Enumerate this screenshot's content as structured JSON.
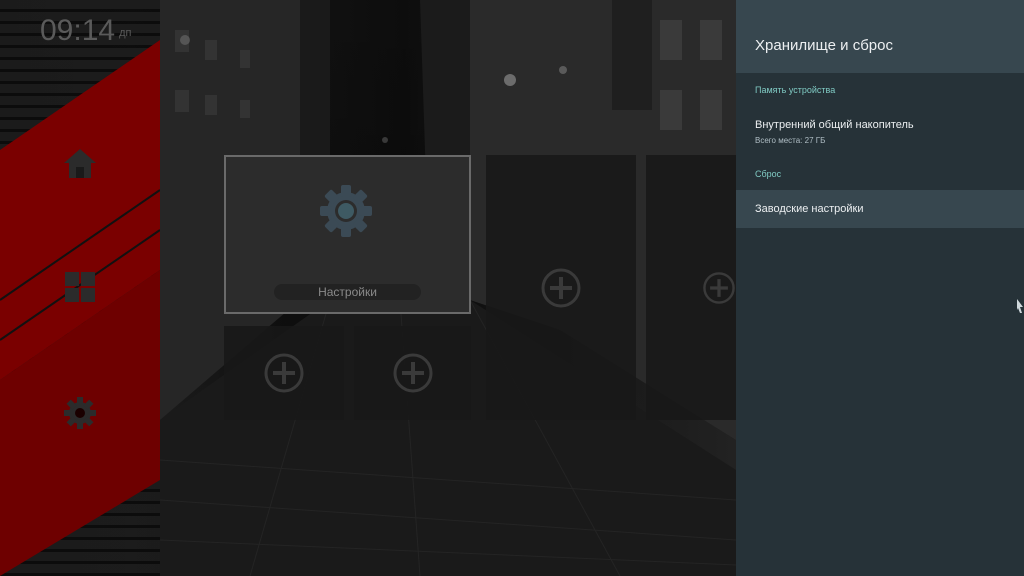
{
  "launcher": {
    "clock": {
      "time": "09:14",
      "ampm": "дп"
    },
    "sidebar": {
      "items": [
        {
          "icon": "home-icon"
        },
        {
          "icon": "apps-grid-icon"
        },
        {
          "icon": "gear-icon"
        }
      ],
      "band_color": "#7a0000"
    },
    "tiles": {
      "selected_label": "Настройки",
      "selected_icon": "gear-icon",
      "empty_icon": "add-circle-icon"
    }
  },
  "settings_panel": {
    "title": "Хранилище и сброс",
    "sections": [
      {
        "label": "Память устройства",
        "items": [
          {
            "title": "Внутренний общий накопитель",
            "subtitle": "Всего места: 27 ГБ"
          }
        ]
      },
      {
        "label": "Сброс",
        "items": [
          {
            "title": "Заводские настройки",
            "focused": true
          }
        ]
      }
    ],
    "colors": {
      "panel_bg": "#263238",
      "header_bg": "#37474f",
      "accent": "#80cbc4"
    }
  }
}
